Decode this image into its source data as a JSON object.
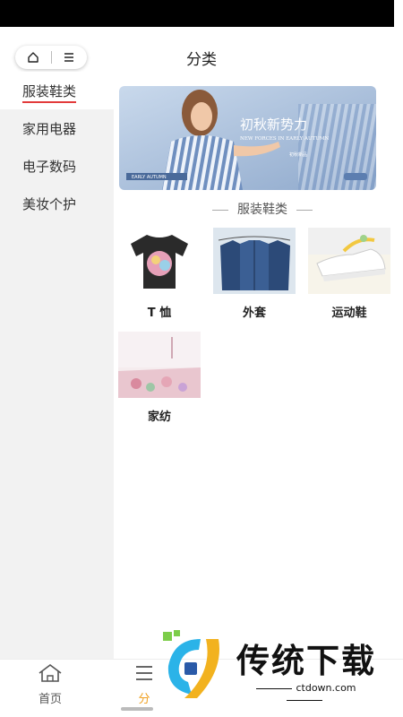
{
  "header": {
    "title": "分类"
  },
  "sidebar": {
    "items": [
      {
        "label": "服装鞋类",
        "active": true
      },
      {
        "label": "家用电器",
        "active": false
      },
      {
        "label": "电子数码",
        "active": false
      },
      {
        "label": "美妆个护",
        "active": false
      }
    ]
  },
  "banner": {
    "headline": "初秋新势力",
    "subline": "NEW FORCES IN EARLY AUTUMN",
    "tag": "EARLY AUTUMN",
    "small": "初秋新品"
  },
  "section": {
    "title": "服装鞋类"
  },
  "products": [
    {
      "label": "T 恤"
    },
    {
      "label": "外套"
    },
    {
      "label": "运动鞋"
    },
    {
      "label": "家纺"
    }
  ],
  "tabbar": {
    "tabs": [
      {
        "label": "首页",
        "icon": "home-icon"
      },
      {
        "label": "分",
        "icon": "category-icon"
      }
    ]
  },
  "watermark": {
    "brand": "传统下载",
    "url": "ctdown.com"
  },
  "colors": {
    "accent": "#e23b3b",
    "sidebar_bg": "#f2f2f2",
    "active_tab": "#f0a020"
  }
}
